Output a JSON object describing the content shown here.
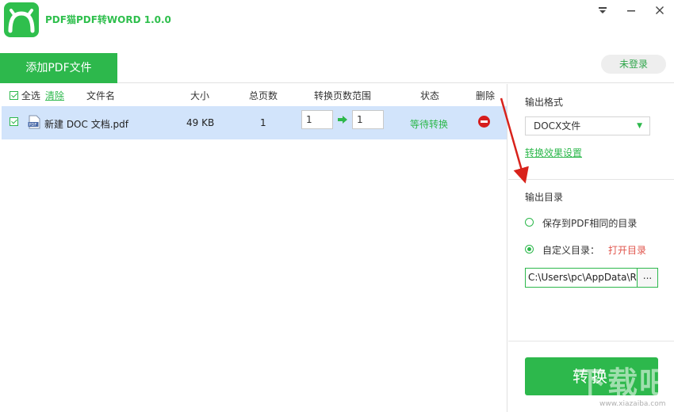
{
  "app": {
    "title": "PDF猫PDF转WORD 1.0.0",
    "accent_color": "#2db84c",
    "window_controls": [
      "menu-icon",
      "minimize-icon",
      "close-icon"
    ]
  },
  "toolbar": {
    "add_pdf_label": "添加PDF文件",
    "login_label": "未登录"
  },
  "table": {
    "select_all_label": "全选",
    "clear_label": "清除",
    "columns": {
      "name": "文件名",
      "size": "大小",
      "pages": "总页数",
      "range": "转换页数范围",
      "status": "状态",
      "delete": "删除"
    },
    "rows": [
      {
        "checked": true,
        "name": "新建 DOC 文档.pdf",
        "size": "49 KB",
        "pages": "1",
        "range_from": "1",
        "range_to": "1",
        "status": "等待转换"
      }
    ]
  },
  "panel": {
    "format_label": "输出格式",
    "format_value": "DOCX文件",
    "effect_settings_label": "转换效果设置",
    "output_dir_label": "输出目录",
    "option_same_dir": "保存到PDF相同的目录",
    "option_custom_dir": "自定义目录：",
    "selected_option": "custom",
    "open_dir_label": "打开目录",
    "path_value": "C:\\Users\\pc\\AppData\\R",
    "browse_label": "...",
    "convert_label": "转换"
  },
  "watermark": {
    "text": "下载吧",
    "url": "www.xiazaiba.com"
  }
}
